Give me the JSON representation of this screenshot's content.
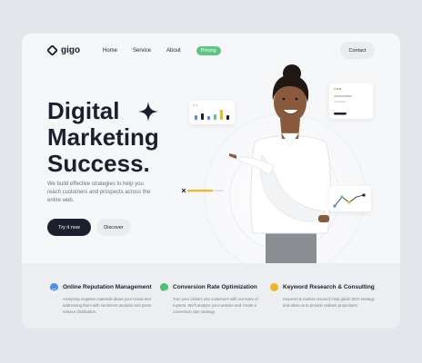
{
  "nav": {
    "logo": "gigo",
    "links": [
      "Home",
      "Service",
      "About"
    ],
    "active_link": "Pricing",
    "contact": "Contact"
  },
  "hero": {
    "title": "Digital\nMarketing\nSuccess.",
    "description": "We build effective strategies to help you reach customers and prospects across the entire web.",
    "primary_button": "Try it now",
    "secondary_button": "Discover"
  },
  "features": [
    {
      "title": "Online Reputation Management",
      "description": "Analyzing negative materials about your brand and addressing them with sentiment analysis and press release distribution.",
      "icon": "globe-icon",
      "color": "#4a8fe0"
    },
    {
      "title": "Conversion Rate Optimization",
      "description": "Turn your visitors into customers with our team of experts. We'll analyze your website and create a conversion rate strategy.",
      "icon": "check-circle-icon",
      "color": "#4fbf6e"
    },
    {
      "title": "Keyword Research & Consulting",
      "description": "Keyword & market research help guide SEO strategy and allow us to provide realistic projections.",
      "icon": "smile-icon",
      "color": "#f3b61f"
    }
  ],
  "colors": {
    "accent_green": "#5dc482",
    "dark": "#1c1f2e",
    "bar_colors": [
      "#4a8fe0",
      "#1c1f2e",
      "#4a8fe0",
      "#5dc482",
      "#f3b61f",
      "#1c1f2e"
    ]
  }
}
